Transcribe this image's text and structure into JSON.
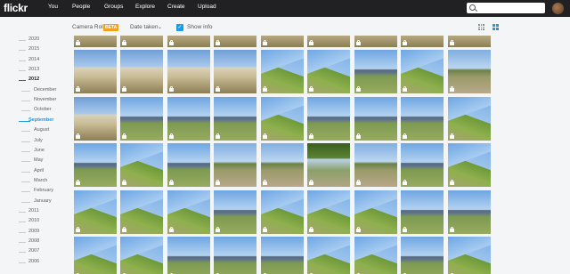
{
  "brand": {
    "logo": "flickr"
  },
  "nav": [
    {
      "key": "you",
      "label": "You"
    },
    {
      "key": "people",
      "label": "People"
    },
    {
      "key": "groups",
      "label": "Groups"
    },
    {
      "key": "explore",
      "label": "Explore"
    },
    {
      "key": "create",
      "label": "Create"
    },
    {
      "key": "upload",
      "label": "Upload"
    }
  ],
  "search": {
    "icon": "search-icon",
    "value": ""
  },
  "toolbar": {
    "camera_roll": "Camera Roll",
    "beta": "BETA",
    "date_taken": "Date taken",
    "show_info": "Show info",
    "show_info_checked": true,
    "view_modes": [
      "grid-small-icon",
      "grid-large-icon"
    ],
    "accent": "#1c9be6"
  },
  "timeline": [
    {
      "label": "2020",
      "kind": "year"
    },
    {
      "label": "2015",
      "kind": "year"
    },
    {
      "label": "2014",
      "kind": "year"
    },
    {
      "label": "2013",
      "kind": "year"
    },
    {
      "label": "2012",
      "kind": "year-active"
    },
    {
      "label": "December",
      "kind": "month"
    },
    {
      "label": "November",
      "kind": "month"
    },
    {
      "label": "October",
      "kind": "month"
    },
    {
      "label": "September",
      "kind": "active"
    },
    {
      "label": "August",
      "kind": "month"
    },
    {
      "label": "July",
      "kind": "month"
    },
    {
      "label": "June",
      "kind": "month"
    },
    {
      "label": "May",
      "kind": "month"
    },
    {
      "label": "April",
      "kind": "month"
    },
    {
      "label": "March",
      "kind": "month"
    },
    {
      "label": "February",
      "kind": "month"
    },
    {
      "label": "January",
      "kind": "month"
    },
    {
      "label": "2011",
      "kind": "year"
    },
    {
      "label": "2010",
      "kind": "year"
    },
    {
      "label": "2009",
      "kind": "year"
    },
    {
      "label": "2008",
      "kind": "year"
    },
    {
      "label": "2007",
      "kind": "year"
    },
    {
      "label": "2006",
      "kind": "year"
    }
  ],
  "photos": [
    [
      "grass",
      "grass",
      "grass",
      "grass",
      "grass",
      "grass",
      "grass",
      "grass",
      "grass"
    ],
    [
      "grass",
      "grass",
      "grass",
      "grass",
      "hill",
      "hill",
      "vista",
      "hill",
      "path"
    ],
    [
      "grass",
      "vista",
      "vista",
      "vista",
      "hill",
      "vista",
      "vista",
      "vista",
      "hill"
    ],
    [
      "vista",
      "hill",
      "vista",
      "path",
      "path",
      "tree",
      "path",
      "vista",
      "hill"
    ],
    [
      "hill",
      "hill",
      "hill",
      "vista",
      "hill",
      "hill",
      "hill",
      "vista",
      "vista"
    ],
    [
      "hill",
      "hill",
      "vista",
      "vista",
      "vista",
      "hill",
      "hill",
      "vista",
      "hill"
    ]
  ],
  "colors": {
    "topbar": "#212124",
    "page": "#f3f5f6",
    "beta": "#f6a01a"
  }
}
